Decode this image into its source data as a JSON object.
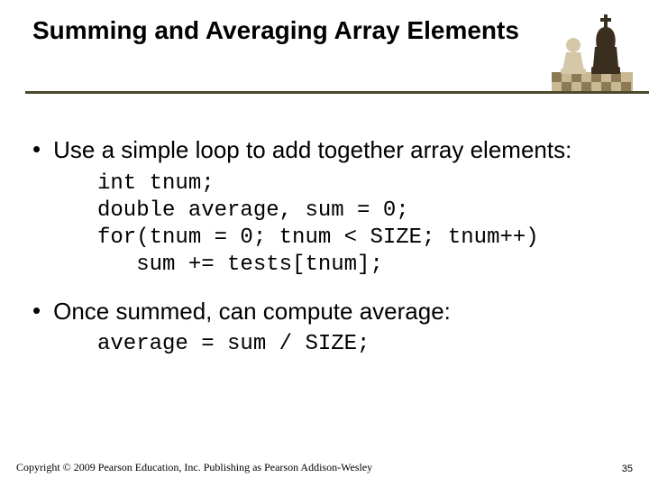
{
  "title": "Summing and Averaging Array Elements",
  "bullets": [
    {
      "text": "Use a simple loop to add together array elements:",
      "code": "int tnum;\ndouble average, sum = 0;\nfor(tnum = 0; tnum < SIZE; tnum++)\n   sum += tests[tnum];"
    },
    {
      "text": "Once summed, can compute average:",
      "code": "average = sum / SIZE;"
    }
  ],
  "footer": {
    "copyright": "Copyright © 2009 Pearson Education, Inc. Publishing as Pearson Addison-Wesley",
    "page": "35"
  }
}
